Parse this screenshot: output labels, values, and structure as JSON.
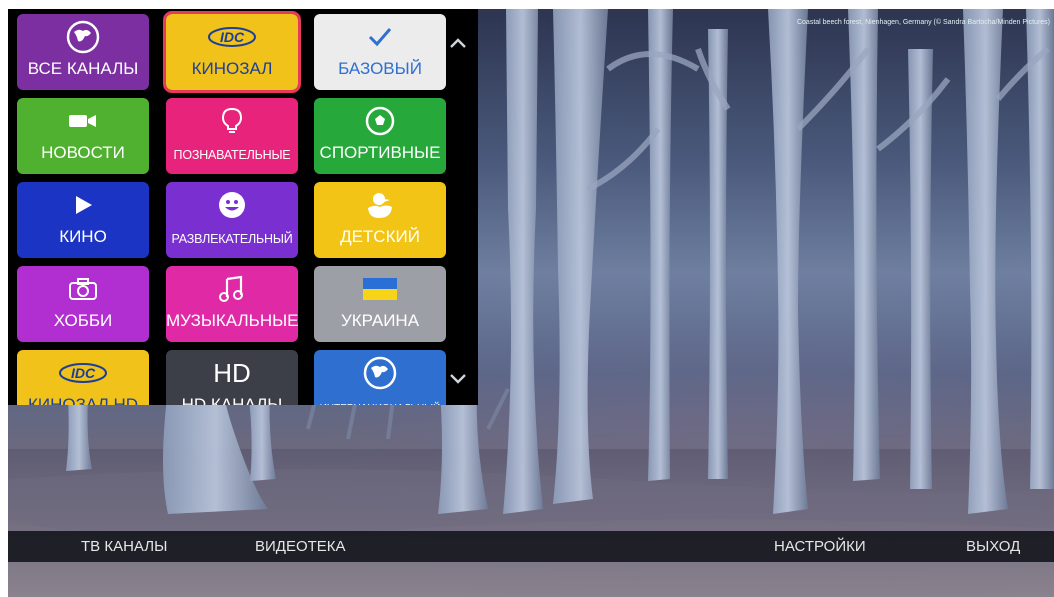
{
  "background": {
    "credit": "Coastal beech forest, Nienhagen, Germany (© Sandra Bartocha/Minden Pictures)"
  },
  "menu": {
    "scroll_up_icon": "chevron-up-icon",
    "scroll_down_icon": "chevron-down-icon",
    "tiles": [
      {
        "label": "ВСЕ КАНАЛЫ",
        "color": "#7b2fa0",
        "icon": "globe-icon",
        "logo": ""
      },
      {
        "label": "КИНОЗАЛ",
        "color": "#f0c21a",
        "icon": "idc-logo-icon",
        "logo": "IDC",
        "selected": true
      },
      {
        "label": "БАЗОВЫЙ",
        "color": "#ececec",
        "icon": "checkmark-icon",
        "logo": ""
      },
      {
        "label": "НОВОСТИ",
        "color": "#4fb12f",
        "icon": "camera-icon",
        "logo": ""
      },
      {
        "label": "ПОЗНАВАТЕЛЬНЫЕ",
        "color": "#e8237c",
        "icon": "lightbulb-icon",
        "logo": ""
      },
      {
        "label": "СПОРТИВНЫЕ",
        "color": "#27a83a",
        "icon": "soccer-ball-icon",
        "logo": ""
      },
      {
        "label": "КИНО",
        "color": "#1c34c4",
        "icon": "play-icon",
        "logo": ""
      },
      {
        "label": "РАЗВЛЕКАТЕЛЬНЫЙ",
        "color": "#7a2fd0",
        "icon": "smiley-icon",
        "logo": ""
      },
      {
        "label": "ДЕТСКИЙ",
        "color": "#f2c416",
        "icon": "duck-icon",
        "logo": ""
      },
      {
        "label": "ХОББИ",
        "color": "#b12fd1",
        "icon": "photo-camera-icon",
        "logo": ""
      },
      {
        "label": "МУЗЫКАЛЬНЫЕ",
        "color": "#e02aa5",
        "icon": "music-note-icon",
        "logo": ""
      },
      {
        "label": "УКРАИНА",
        "color": "#9d9fa6",
        "icon": "ukraine-flag-icon",
        "logo": ""
      },
      {
        "label": "КИНОЗАЛ HD",
        "color": "#f0c21a",
        "icon": "idc-logo-icon",
        "logo": "IDC"
      },
      {
        "label": "HD КАНАЛЫ",
        "color": "#3d3f48",
        "icon": "hd-icon",
        "logo": "HD"
      },
      {
        "label": "ИНТЕРНАЦИОНАЛЬНЫЙ",
        "color": "#2f6fd0",
        "icon": "globe-icon",
        "logo": ""
      }
    ]
  },
  "bottom_nav": {
    "tv": "ТВ КАНАЛЫ",
    "video": "ВИДЕОТЕКА",
    "settings": "НАСТРОЙКИ",
    "exit": "ВЫХОД"
  }
}
